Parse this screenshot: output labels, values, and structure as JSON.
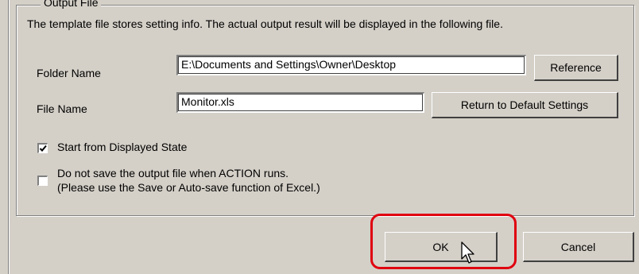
{
  "group": {
    "title": "Output File",
    "description": "The template file stores setting info. The actual output result will be displayed in the following file."
  },
  "folder": {
    "label": "Folder Name",
    "value": "E:\\Documents and Settings\\Owner\\Desktop",
    "button": "Reference"
  },
  "file": {
    "label": "File Name",
    "value": "Monitor.xls",
    "button": "Return to Default Settings"
  },
  "options": {
    "start_from_displayed": {
      "label": "Start from Displayed State",
      "checked": true
    },
    "do_not_save": {
      "line1": "Do not save the output file when ACTION runs.",
      "line2": "(Please use the Save or Auto-save function of Excel.)",
      "checked": false
    }
  },
  "buttons": {
    "ok": "OK",
    "cancel": "Cancel"
  },
  "colors": {
    "dialog_bg": "#d4d0c8",
    "highlight": "#e0000f"
  },
  "icons": [
    "check-icon",
    "arrow-cursor-icon"
  ]
}
